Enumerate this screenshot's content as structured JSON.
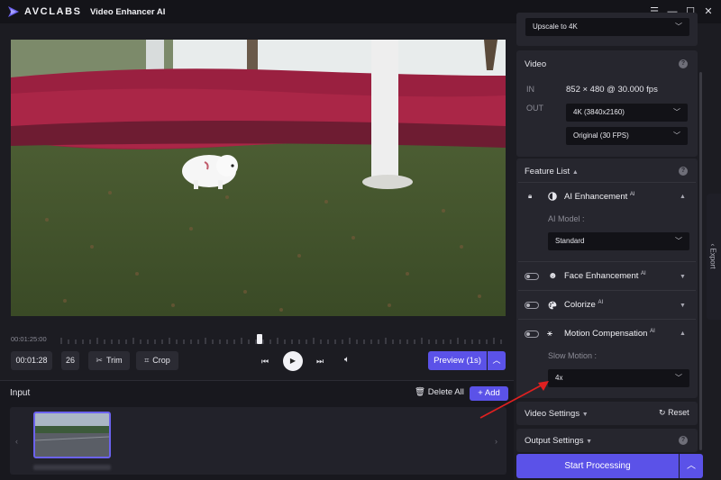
{
  "titlebar": {
    "brand": "AVCLABS",
    "app_title": "Video Enhancer AI",
    "icons": {
      "menu": "menu-icon",
      "minimize": "minimize-icon",
      "maximize": "maximize-icon",
      "close": "close-icon"
    }
  },
  "player": {
    "timeline_time": "00:01:25:00",
    "current_time": "00:01:28",
    "frame": "26",
    "trim_label": "Trim",
    "crop_label": "Crop",
    "preview_label": "Preview (1s)"
  },
  "input": {
    "title": "Input",
    "delete_all": "Delete All",
    "add": "Add"
  },
  "right": {
    "upscale_select": "Upscale to 4K",
    "video": {
      "title": "Video",
      "in_label": "IN",
      "in_value": "852 × 480 @ 30.000 fps",
      "out_label": "OUT",
      "resolution": "4K (3840x2160)",
      "framerate": "Original (30 FPS)"
    },
    "feature_list": {
      "title": "Feature List",
      "ai_enhancement": "AI Enhancement",
      "ai_sup": "AI",
      "ai_model_label": "AI Model :",
      "ai_model_value": "Standard",
      "face_enhancement": "Face Enhancement",
      "colorize": "Colorize",
      "motion_compensation": "Motion Compensation",
      "slow_motion_label": "Slow Motion :",
      "slow_motion_value": "4x"
    },
    "video_settings": "Video Settings",
    "reset": "Reset",
    "output_settings": "Output Settings",
    "start_processing": "Start Processing",
    "export": "Export"
  },
  "colors": {
    "accent": "#5b52e8",
    "background": "#1c1c22",
    "panel": "#26262e",
    "annotation_arrow": "#e02020"
  }
}
